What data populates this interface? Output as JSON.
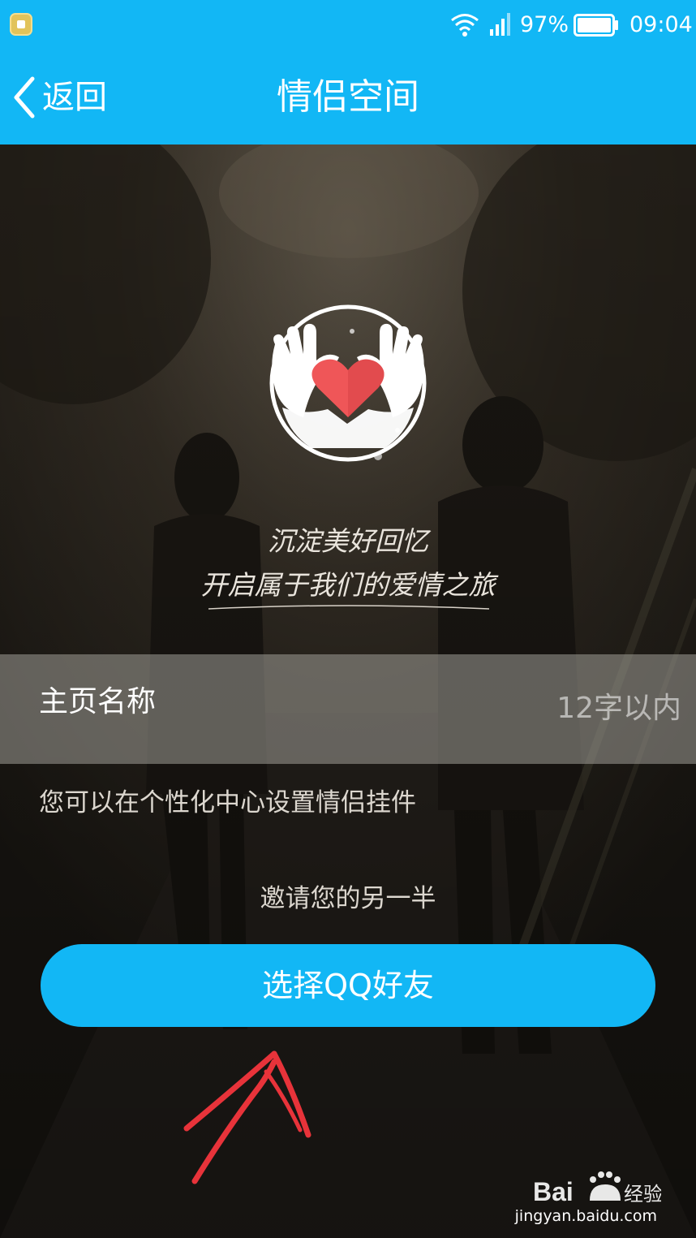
{
  "status_bar": {
    "battery_percent": "97%",
    "time": "09:04",
    "icons": [
      "notification-icon",
      "wifi-icon",
      "signal-icon",
      "battery-icon"
    ]
  },
  "title_bar": {
    "back_label": "返回",
    "title": "情侣空间"
  },
  "hero": {
    "logo_icon": "heart-hands-icon",
    "slogan_line1": "沉淀美好回忆",
    "slogan_line2": "开启属于我们的爱情之旅"
  },
  "form": {
    "name_label": "主页名称",
    "name_value": "",
    "name_placeholder": "12字以内",
    "pendant_hint": "您可以在个性化中心设置情侣挂件"
  },
  "invite": {
    "label": "邀请您的另一半",
    "button_label": "选择QQ好友"
  },
  "watermark": {
    "logo_text": "Bai经验",
    "url": "jingyan.baidu.com"
  },
  "colors": {
    "accent": "#12b7f5",
    "annotation": "#e8333a",
    "heart": "#ef5658"
  }
}
